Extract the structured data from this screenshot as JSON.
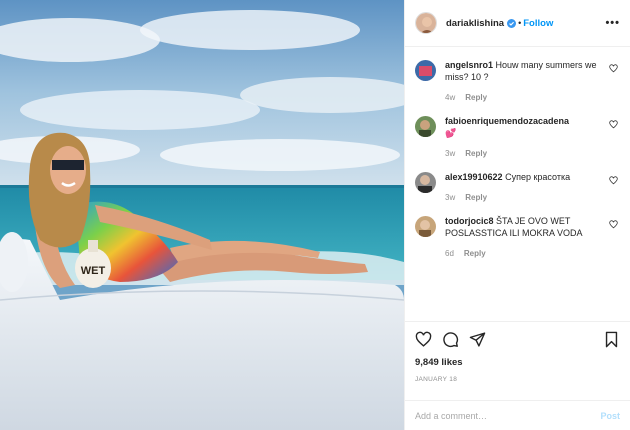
{
  "header": {
    "username": "dariaklishina",
    "separator": "•",
    "follow_label": "Follow",
    "more_label": "•••"
  },
  "comments": [
    {
      "username": "angelsnro1",
      "text": "Houw many summers we miss? 10 ?",
      "time": "4w",
      "reply_label": "Reply"
    },
    {
      "username": "fabioenriquemendozacadena",
      "text": "💕",
      "time": "3w",
      "reply_label": "Reply"
    },
    {
      "username": "alex19910622",
      "text": "Супер красотка",
      "time": "3w",
      "reply_label": "Reply"
    },
    {
      "username": "todorjocic8",
      "text": "ŠTA JE OVO WET POSLASSTICA ILI MOKRA VODA",
      "time": "6d",
      "reply_label": "Reply"
    }
  ],
  "photo": {
    "bottle_label": "WET"
  },
  "stats": {
    "likes": "9,849 likes",
    "date": "JANUARY 18"
  },
  "add_comment": {
    "placeholder": "Add a comment…",
    "post_label": "Post"
  },
  "colors": {
    "link_blue": "#0095f6",
    "post_disabled": "#b2dffc",
    "verified_blue": "#3897f0",
    "meta_gray": "#8e8e8e"
  },
  "icons": {
    "like": "heart-icon",
    "comment": "comment-icon",
    "share": "paper-plane-icon",
    "save": "bookmark-icon"
  }
}
